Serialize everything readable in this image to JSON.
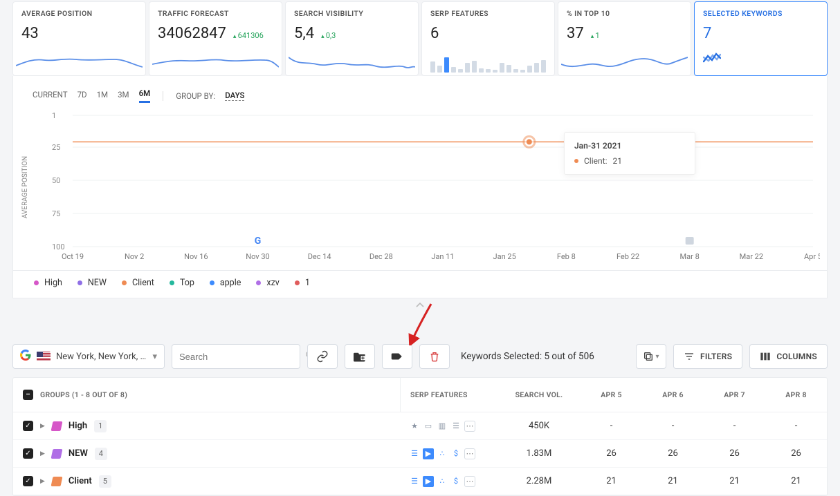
{
  "metrics": {
    "avg_position": {
      "title": "AVERAGE POSITION",
      "value": "43"
    },
    "traffic": {
      "title": "TRAFFIC FORECAST",
      "value": "34062847",
      "delta": "641306"
    },
    "visibility": {
      "title": "SEARCH VISIBILITY",
      "value": "5,4",
      "delta": "0,3"
    },
    "serp": {
      "title": "SERP FEATURES",
      "value": "6"
    },
    "top10": {
      "title": "% IN TOP 10",
      "value": "37",
      "delta": "1"
    },
    "selected": {
      "title": "SELECTED KEYWORDS",
      "value": "7"
    }
  },
  "chart_toolbar": {
    "tabs": [
      "CURRENT",
      "7D",
      "1M",
      "3M",
      "6M"
    ],
    "active_index": 4,
    "group_by_label": "GROUP BY:",
    "group_by_value": "DAYS"
  },
  "chart_data": {
    "type": "line",
    "title": "",
    "xlabel": "",
    "ylabel": "AVERAGE POSITION",
    "ylim": [
      1,
      100
    ],
    "y_ticks": [
      1,
      25,
      50,
      75,
      100
    ],
    "x_ticks": [
      "Oct 19",
      "Nov 2",
      "Nov 16",
      "Nov 30",
      "Dec 14",
      "Dec 28",
      "Jan 11",
      "Jan 25",
      "Feb 8",
      "Feb 22",
      "Mar 8",
      "Mar 22",
      "Apr 5"
    ],
    "series": [
      {
        "name": "High",
        "color": "#d657c8"
      },
      {
        "name": "NEW",
        "color": "#8f6fe6"
      },
      {
        "name": "Client",
        "color": "#ef8b53",
        "constant_value": 21
      },
      {
        "name": "Top",
        "color": "#24b89d"
      },
      {
        "name": "apple",
        "color": "#3d8bfd"
      },
      {
        "name": "xzv",
        "color": "#b06fe6"
      },
      {
        "name": "1",
        "color": "#e05c5c"
      }
    ],
    "hover": {
      "date": "Jan-31 2021",
      "series": "Client",
      "value": 21
    }
  },
  "controls": {
    "location": "New York, New York, …",
    "search_placeholder": "Search",
    "selected_text": "Keywords Selected: 5 out of 506",
    "filters_label": "FILTERS",
    "columns_label": "COLUMNS"
  },
  "table": {
    "header": {
      "groups": "GROUPS (1 - 8 OUT OF 8)",
      "serp": "SERP FEATURES",
      "vol": "SEARCH VOL.",
      "dates": [
        "APR 5",
        "APR 6",
        "APR 7",
        "APR 8"
      ]
    },
    "rows": [
      {
        "label": "High",
        "count": "1",
        "tag": "tag-pink",
        "serp_style": "grey",
        "vol": "450K",
        "cells": [
          "-",
          "-",
          "-",
          "-"
        ]
      },
      {
        "label": "NEW",
        "count": "4",
        "tag": "tag-purple",
        "serp_style": "blue",
        "vol": "1.83M",
        "cells": [
          "26",
          "26",
          "26",
          "26"
        ]
      },
      {
        "label": "Client",
        "count": "5",
        "tag": "tag-orange",
        "serp_style": "blue",
        "vol": "2.28M",
        "cells": [
          "21",
          "21",
          "21",
          "21"
        ]
      }
    ]
  }
}
